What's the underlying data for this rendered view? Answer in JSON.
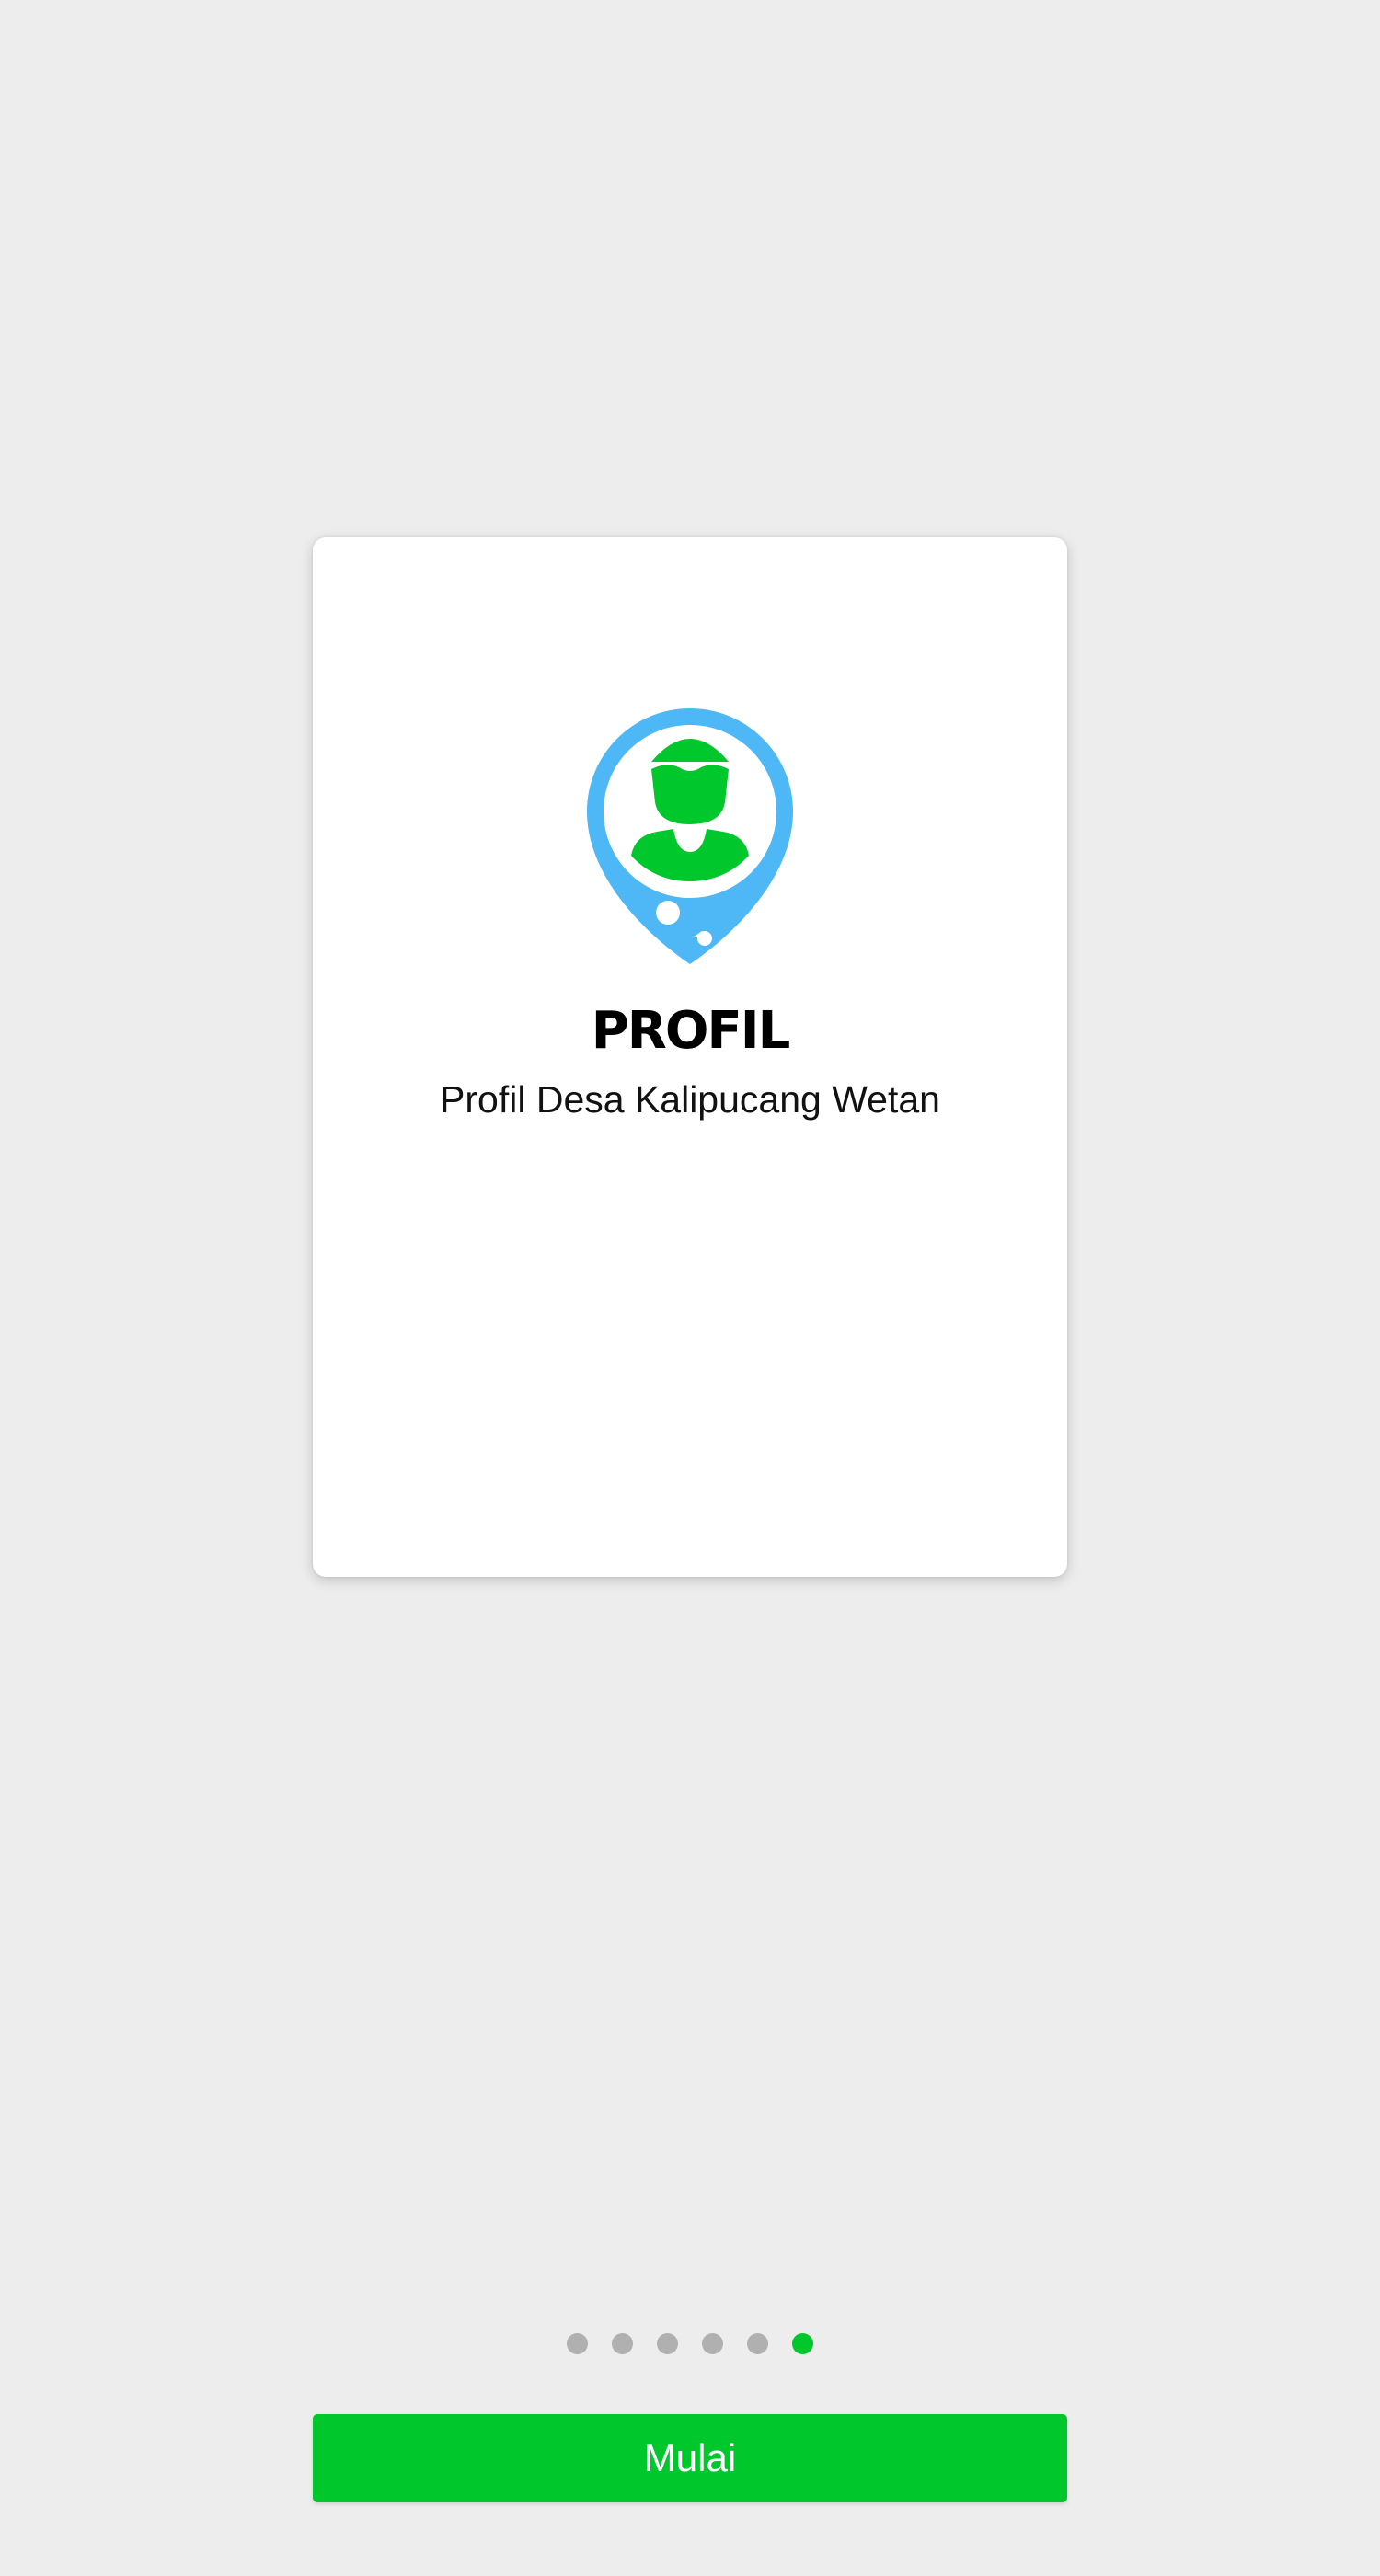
{
  "onboarding": {
    "card": {
      "icon": "profile-location-pin-icon",
      "title": "PROFIL",
      "subtitle": "Profil Desa Kalipucang Wetan"
    },
    "pagination": {
      "total": 6,
      "active_index": 5
    },
    "start_label": "Mulai"
  },
  "colors": {
    "background": "#ededed",
    "accent_green": "#00c72c",
    "pin_blue": "#4db8f5",
    "dot_inactive": "#b0b0b0"
  }
}
